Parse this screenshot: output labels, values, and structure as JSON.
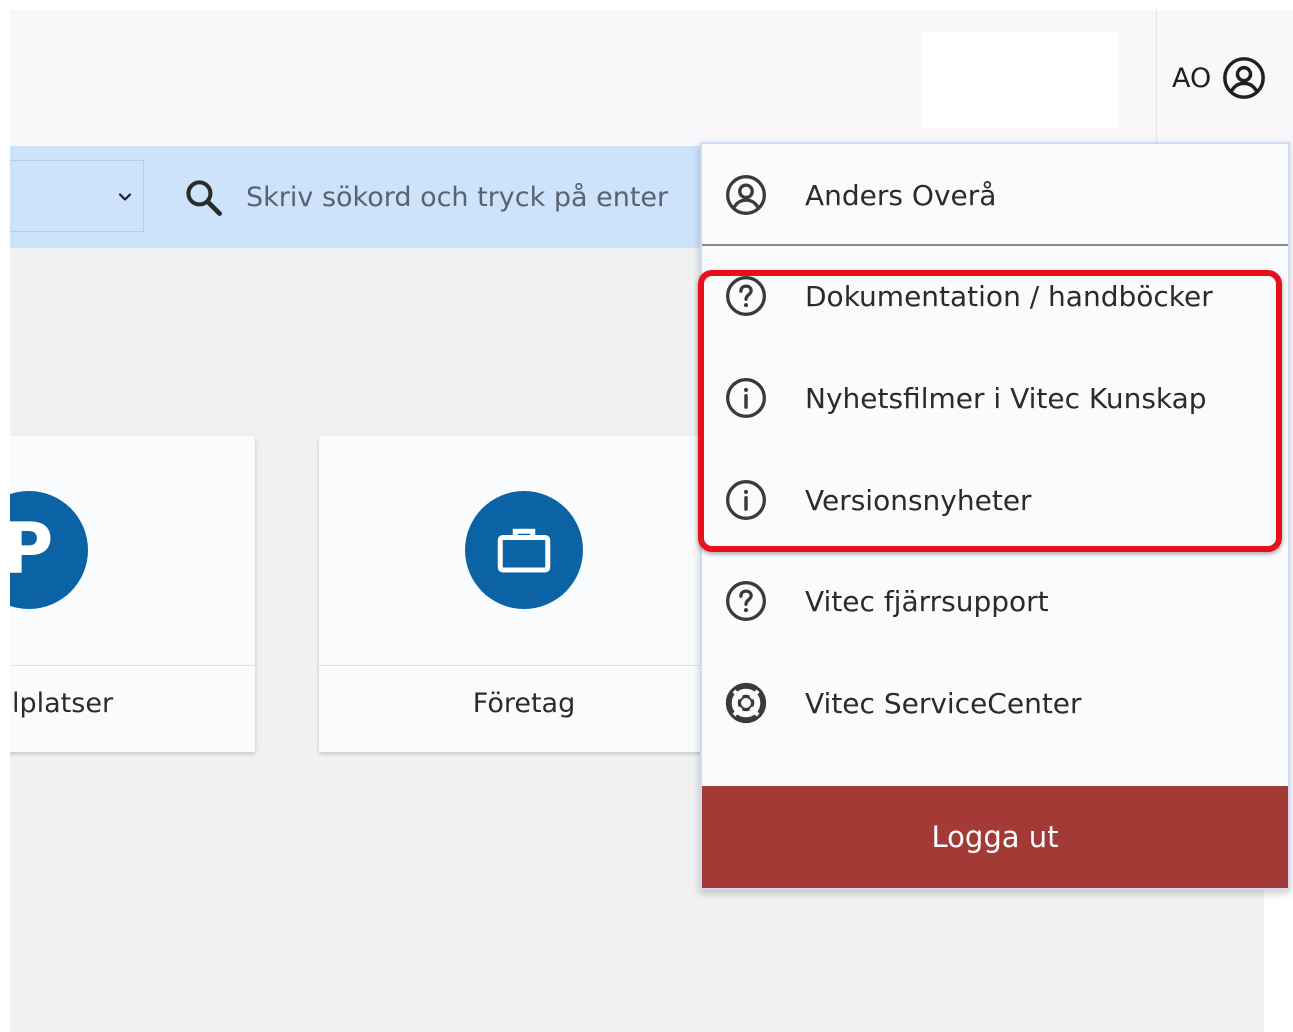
{
  "header": {
    "user_initials": "AO",
    "user_icon": "user-circle-icon"
  },
  "search": {
    "placeholder": "Skriv sökord och tryck på enter",
    "value": "",
    "scope_select_icon": "chevron-down-icon",
    "search_icon": "search-icon"
  },
  "tiles": [
    {
      "label": "lplatser",
      "icon": "parking-icon",
      "icon_letter": "P"
    },
    {
      "label": "Företag",
      "icon": "briefcase-icon"
    }
  ],
  "user_menu": {
    "user_name": "Anders Overå",
    "items": [
      {
        "label": "Dokumentation / handböcker",
        "icon": "help-circle-icon"
      },
      {
        "label": "Nyhetsfilmer i Vitec Kunskap",
        "icon": "info-circle-icon"
      },
      {
        "label": "Versionsnyheter",
        "icon": "info-circle-icon"
      },
      {
        "label": "Vitec fjärrsupport",
        "icon": "help-circle-icon"
      },
      {
        "label": "Vitec ServiceCenter",
        "icon": "lifebuoy-icon"
      }
    ],
    "logout_label": "Logga ut"
  },
  "colors": {
    "primary_blue": "#0b63a5",
    "search_bar_bg": "#cde3fb",
    "logout_red": "#a33a35",
    "highlight_red": "#e8101a"
  }
}
